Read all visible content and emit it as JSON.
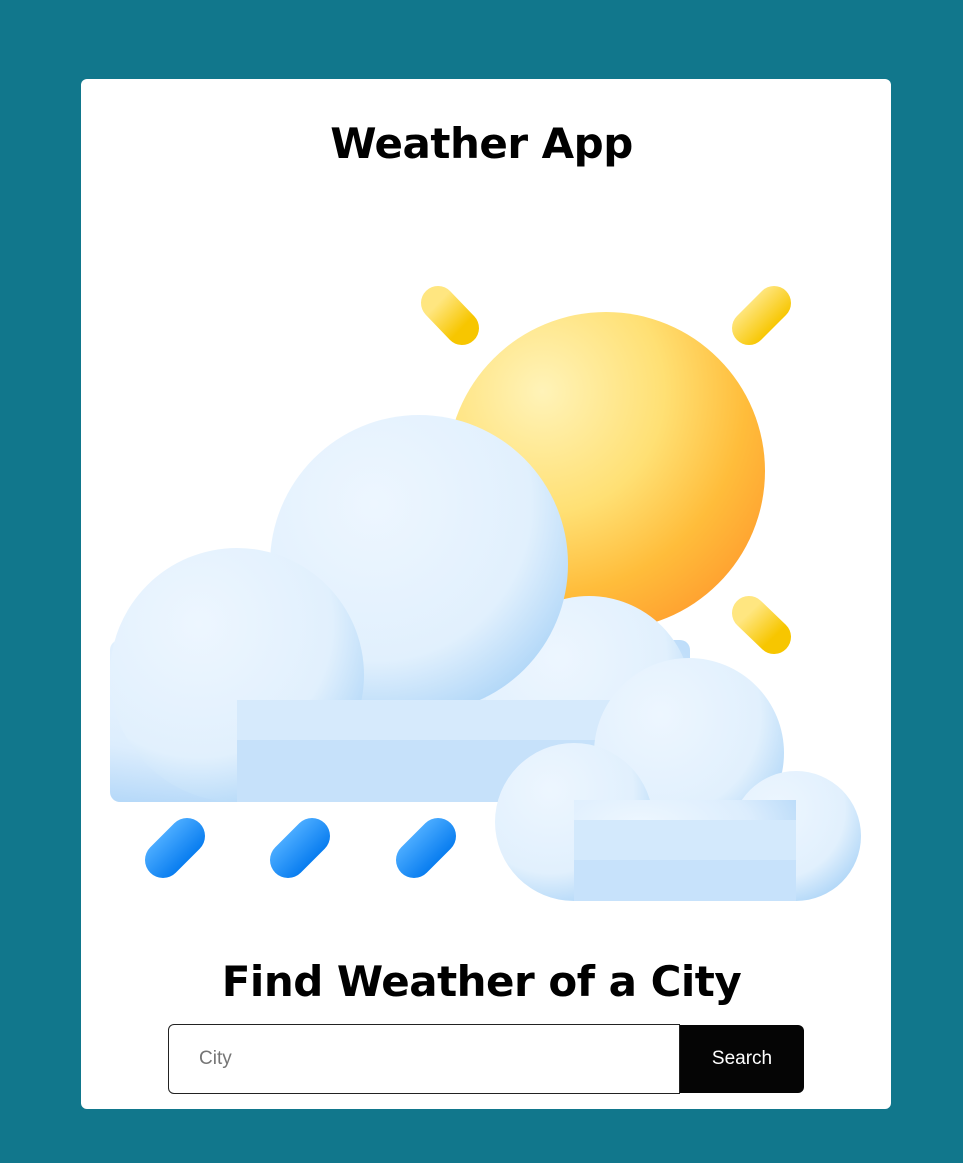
{
  "header": {
    "title": "Weather App"
  },
  "illustration": {
    "icon": "sun-behind-rain-cloud-icon",
    "colors": {
      "background": "#11778c",
      "sun": "#ffc83d",
      "sun_rays": "#fcd116",
      "cloud": "#e3f1fd",
      "rain": "#1e90ff"
    }
  },
  "search": {
    "heading": "Find Weather of a City",
    "input_value": "",
    "placeholder": "City",
    "button_label": "Search"
  }
}
